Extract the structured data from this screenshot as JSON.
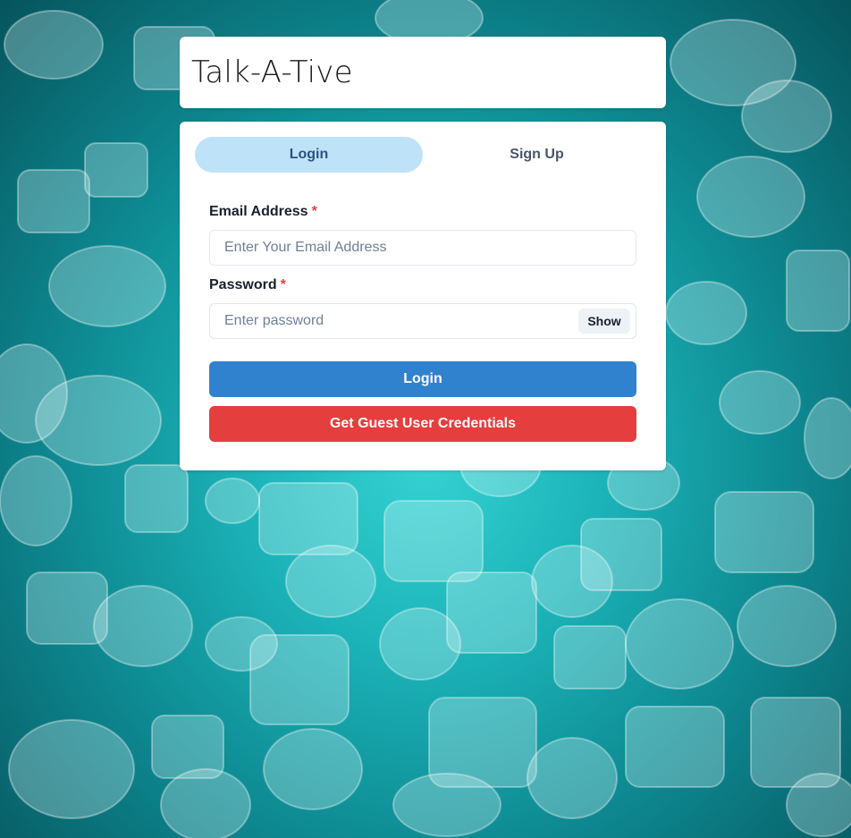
{
  "app": {
    "title": "Talk-A-Tive"
  },
  "tabs": [
    {
      "label": "Login",
      "active": true
    },
    {
      "label": "Sign Up",
      "active": false
    }
  ],
  "form": {
    "email_label": "Email Address",
    "email_required": "*",
    "email_placeholder": "Enter Your Email Address",
    "email_value": "",
    "password_label": "Password",
    "password_required": "*",
    "password_placeholder": "Enter password",
    "password_value": "",
    "show_label": "Show",
    "login_button": "Login",
    "guest_button": "Get Guest User Credentials"
  },
  "colors": {
    "active_tab_bg": "#bee3f8",
    "login_button": "#3182ce",
    "guest_button": "#e53e3e",
    "required_marker": "#e53e3e",
    "background_teal": "#1bb3b8"
  },
  "background": {
    "pattern": "speech-bubbles"
  }
}
